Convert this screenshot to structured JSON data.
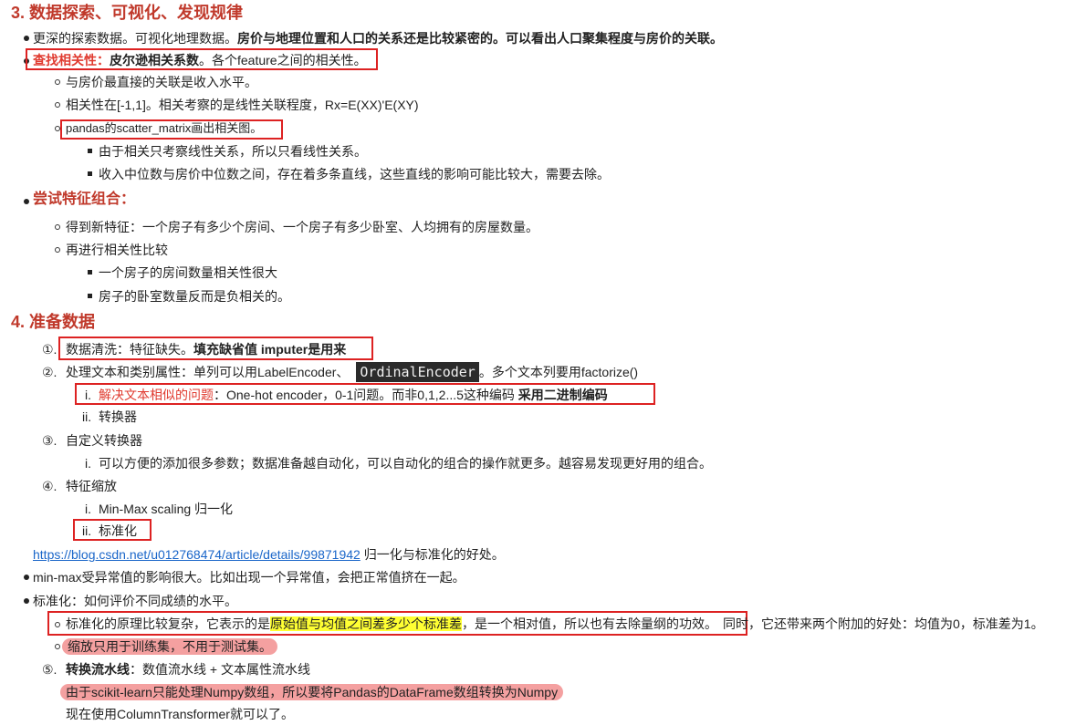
{
  "section3": {
    "title": "3. 数据探索、可视化、发现规律",
    "l1_plain": "更深的探索数据。可视化地理数据。",
    "l1_bold": "房价与地理位置和人口的关系还是比较紧密的。可以看出人口聚集程度与房价的关联。",
    "l2_red": "查找相关性：",
    "l2_bold": "皮尔逊相关系数",
    "l2_plain": "。各个feature之间的相关性。",
    "l2_sub1": "与房价最直接的关联是收入水平。",
    "l2_sub2": "相关性在[-1,1]。相关考察的是线性关联程度，Rx=E(XX)'E(XY)",
    "l2_sub3": "pandas的scatter_matrix画出相关图。",
    "l2_sub3_a": "由于相关只考察线性关系，所以只看线性关系。",
    "l2_sub3_b": "收入中位数与房价中位数之间，存在着多条直线，这些直线的影响可能比较大，需要去除。",
    "l3": "尝试特征组合：",
    "l3_sub1": "得到新特征：一个房子有多少个房间、一个房子有多少卧室、人均拥有的房屋数量。",
    "l3_sub2": "再进行相关性比较",
    "l3_sub2_a": "一个房子的房间数量相关性很大",
    "l3_sub2_b": "房子的卧室数量反而是负相关的。"
  },
  "section4": {
    "title": "4. 准备数据",
    "n1_num": "①.",
    "n1_plain": "数据清洗：特征缺失。",
    "n1_bold": "填充缺省值 imputer是用来",
    "n2_num": "②.",
    "n2_a": "处理文本和类别属性：单列可以用LabelEncoder、",
    "n2_code": "OrdinalEncoder",
    "n2_b": "。多个文本列要用factorize()",
    "n2_i_num": "i.",
    "n2_i_red": "解决文本相似的问题",
    "n2_i_plain": "：One-hot encoder，0-1问题。而非0,1,2...5这种编码",
    "n2_i_bold": "采用二进制编码",
    "n2_ii_num": "ii.",
    "n2_ii": "转换器",
    "n3_num": "③.",
    "n3": "自定义转换器",
    "n3_i_num": "i.",
    "n3_i": "可以方便的添加很多参数；数据准备越自动化，可以自动化的组合的操作就更多。越容易发现更好用的组合。",
    "n4_num": "④.",
    "n4": "特征缩放",
    "n4_i_num": "i.",
    "n4_i": "Min-Max scaling 归一化",
    "n4_ii_num": "ii.",
    "n4_ii": "标准化",
    "link": "https://blog.csdn.net/u012768474/article/details/99871942",
    "link_after": " 归一化与标准化的好处。",
    "b1": "min-max受异常值的影响很大。比如出现一个异常值，会把正常值挤在一起。",
    "b2": "标准化：如何评价不同成绩的水平。",
    "b2_sub1_a": "标准化的原理比较复杂，它表示的是",
    "b2_sub1_hl": "原始值与均值之间差多少个标准差",
    "b2_sub1_b": "，是一个相对值，所以也有去除量纲的功效。",
    "b2_sub1_c": "同时，它还带来两个附加的好处：均值为0，标准差为1。",
    "b2_sub2": "缩放只用于训练集，不用于测试集。",
    "n5_num": "⑤.",
    "n5_bold": "转换流水线",
    "n5_plain": "：数值流水线 + 文本属性流水线",
    "n5_note": "由于scikit-learn只能处理Numpy数组，所以要将Pandas的DataFrame数组转换为Numpy",
    "n5_last": "现在使用ColumnTransformer就可以了。"
  },
  "colors": {
    "heading": "#c0392b",
    "accent_red": "#e03a2f",
    "highlight": "#ffff33",
    "pill": "#f4a0a0",
    "link": "#1a66c9"
  }
}
